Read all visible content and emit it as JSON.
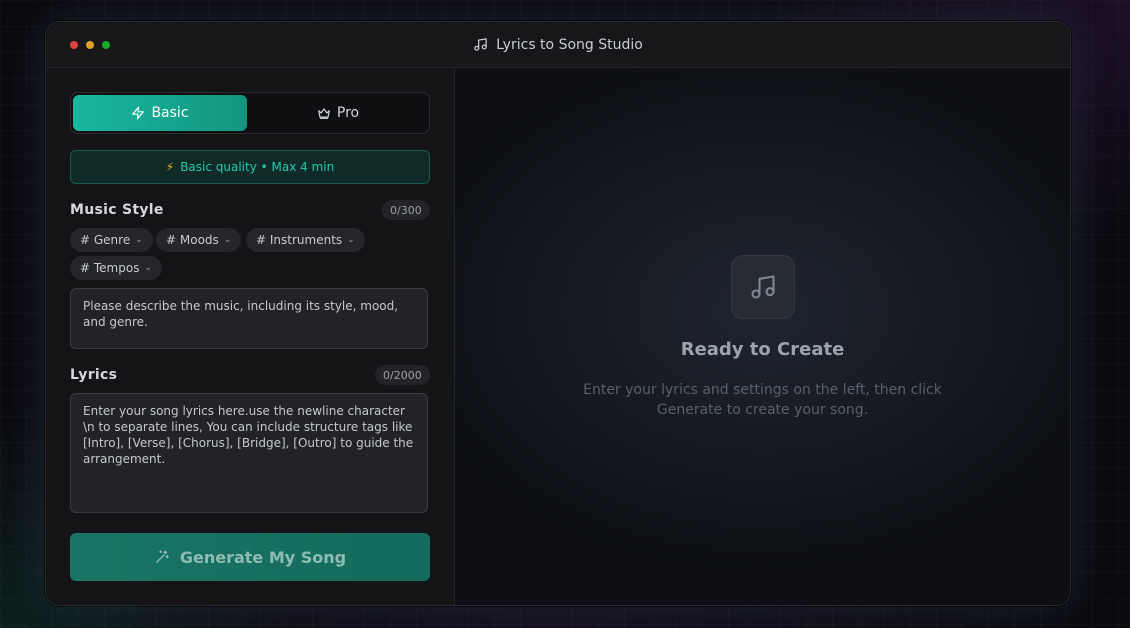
{
  "app": {
    "title": "Lyrics to Song Studio"
  },
  "mode": {
    "basic_label": "Basic",
    "pro_label": "Pro",
    "selected": "Basic"
  },
  "quality_banner": "Basic quality • Max 4 min",
  "music_style": {
    "label": "Music Style",
    "counter": "0/300",
    "tags": [
      "# Genre",
      "# Moods",
      "# Instruments",
      "# Tempos"
    ],
    "placeholder": "Please describe the music, including its style, mood, and genre."
  },
  "lyrics": {
    "label": "Lyrics",
    "counter": "0/2000",
    "placeholder": "Enter your song lyrics here.use the newline character \\n to separate lines, You can include structure tags like [Intro], [Verse], [Chorus], [Bridge], [Outro] to guide the arrangement."
  },
  "generate_label": "Generate My Song",
  "preview": {
    "title": "Ready to Create",
    "desc_line1": "Enter your lyrics and settings on the left, then click",
    "desc_line2": "Generate to create your song."
  },
  "colors": {
    "accent": "#17b89e",
    "quality_text": "#25c8ac",
    "bolt": "#f1b62b"
  }
}
